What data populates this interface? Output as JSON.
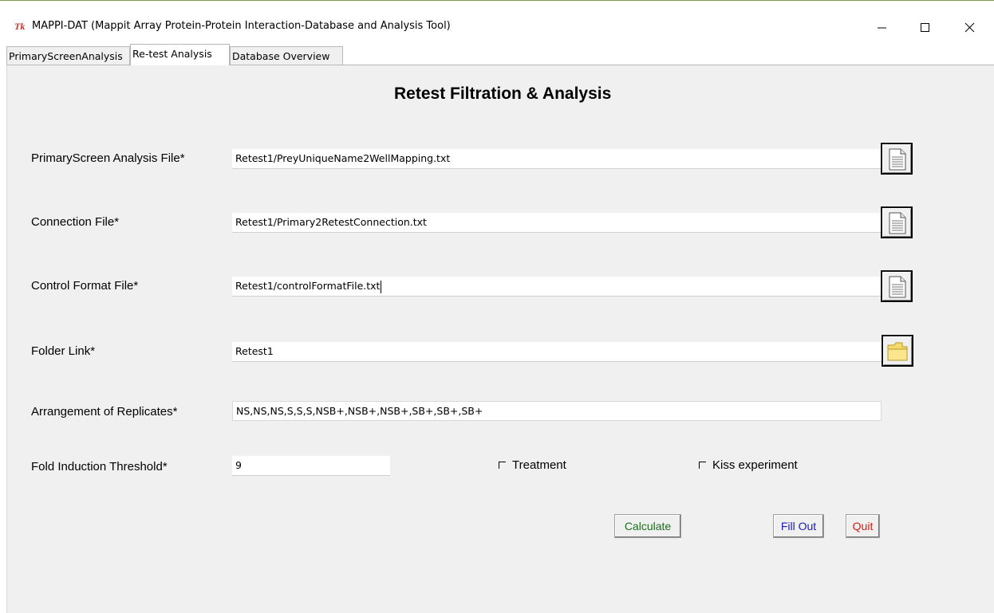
{
  "window": {
    "icon_text": "Tk",
    "title": "MAPPI-DAT (Mappit Array Protein-Protein Interaction-Database and Analysis Tool)"
  },
  "tabs": [
    {
      "label": "PrimaryScreenAnalysis",
      "active": false
    },
    {
      "label": "Re-test Analysis",
      "active": true
    },
    {
      "label": "Database Overview",
      "active": false
    }
  ],
  "page": {
    "heading": "Retest Filtration & Analysis"
  },
  "fields": {
    "primary_screen": {
      "label": "PrimaryScreen Analysis File*",
      "value": "Retest1/PreyUniqueName2WellMapping.txt"
    },
    "connection": {
      "label": "Connection File*",
      "value": "Retest1/Primary2RetestConnection.txt"
    },
    "control_format": {
      "label": "Control Format File*",
      "value": "Retest1/controlFormatFile.txt"
    },
    "folder_link": {
      "label": "Folder Link*",
      "value": "Retest1"
    },
    "replicates": {
      "label": "Arrangement of Replicates*",
      "value": "NS,NS,NS,S,S,S,NSB+,NSB+,NSB+,SB+,SB+,SB+"
    },
    "fold_induction": {
      "label": "Fold Induction Threshold*",
      "value": "9"
    }
  },
  "checkboxes": {
    "treatment": {
      "label": "Treatment",
      "checked": false
    },
    "kiss": {
      "label": "Kiss experiment",
      "checked": false
    }
  },
  "buttons": {
    "calculate": "Calculate",
    "fill_out": "Fill Out",
    "quit": "Quit"
  },
  "colors": {
    "calculate_text": "#1a6e1a",
    "fill_out_text": "#1b1bb8",
    "quit_text": "#d41a1a",
    "panel_bg": "#f0f0f0"
  },
  "icons": {
    "file_browse": "document-icon",
    "folder_browse": "folder-icon"
  }
}
